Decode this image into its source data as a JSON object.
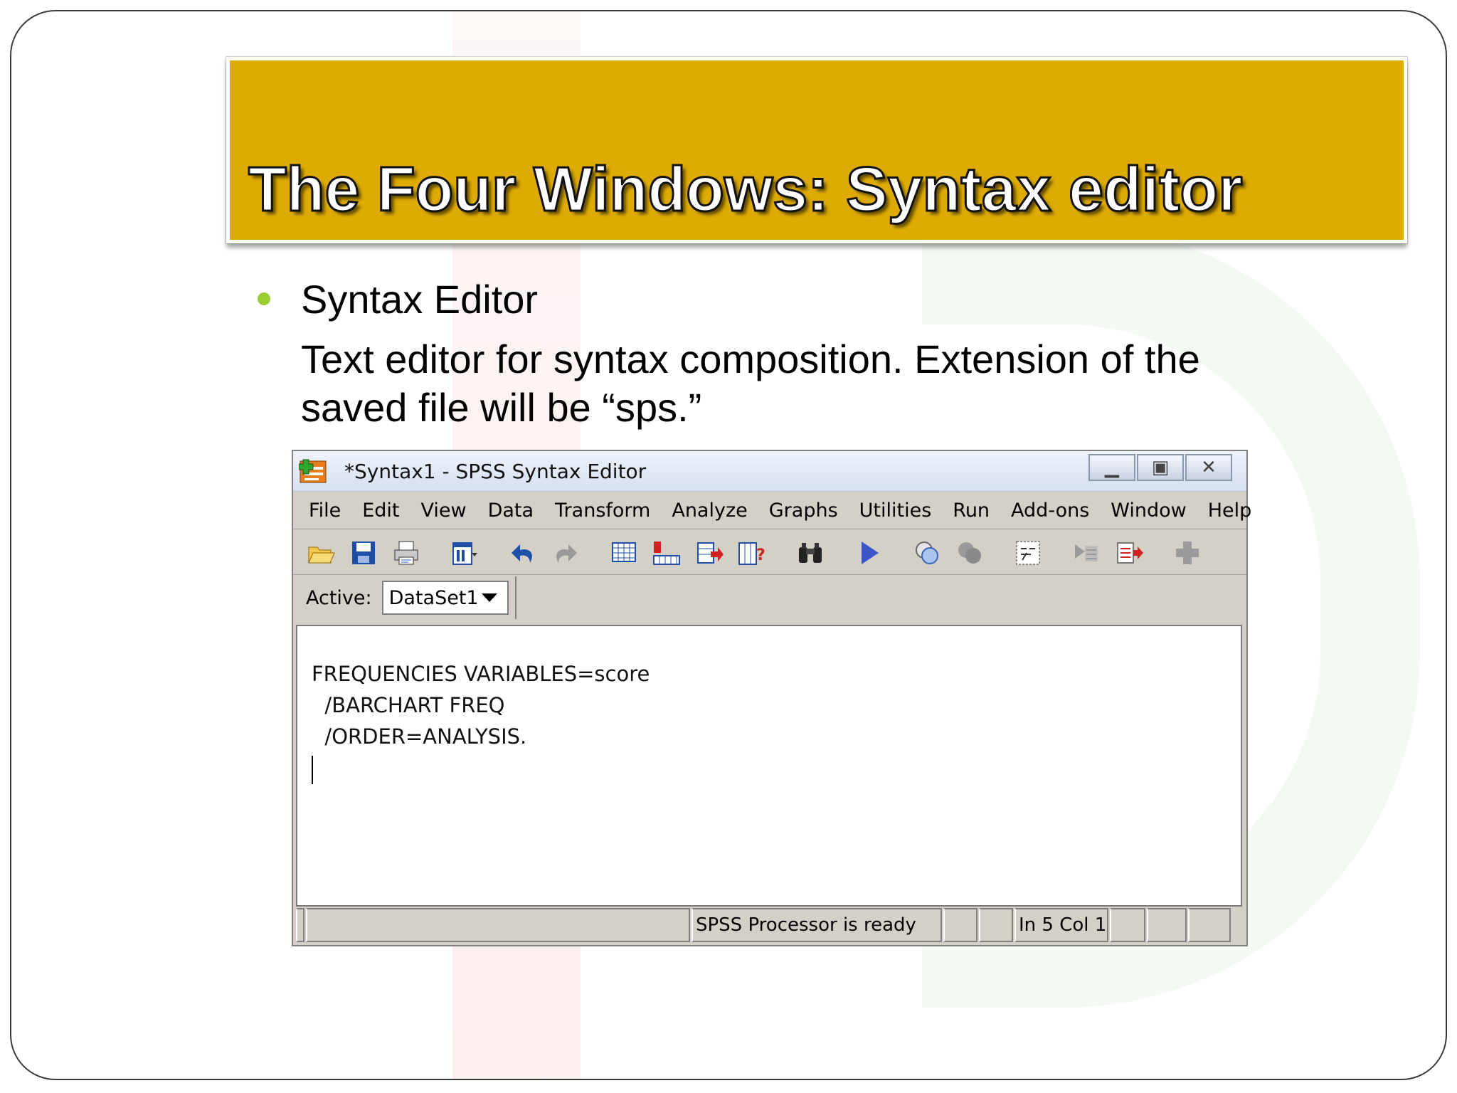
{
  "slide": {
    "title": "The Four Windows: Syntax editor",
    "bullet_heading": "Syntax Editor",
    "bullet_body": "Text editor for syntax composition. Extension of the saved file will be “sps.”"
  },
  "spss_window": {
    "title": "*Syntax1 - SPSS Syntax Editor",
    "menu": [
      "File",
      "Edit",
      "View",
      "Data",
      "Transform",
      "Analyze",
      "Graphs",
      "Utilities",
      "Run",
      "Add-ons",
      "Window",
      "Help"
    ],
    "toolbar_icons": [
      "open-icon",
      "save-icon",
      "print-icon",
      "dialog-recall-icon",
      "undo-icon",
      "redo-icon",
      "goto-data-icon",
      "goto-case-icon",
      "insert-variable-icon",
      "variables-icon",
      "find-icon",
      "run-icon",
      "bookmark-icon",
      "comment-icon",
      "syntax-help-icon",
      "indent-icon",
      "output-icon",
      "add-icon"
    ],
    "active_label": "Active:",
    "active_dataset": "DataSet1",
    "syntax_lines": [
      "FREQUENCIES VARIABLES=score",
      "  /BARCHART FREQ",
      "  /ORDER=ANALYSIS."
    ],
    "status_processor": "SPSS  Processor is ready",
    "status_position": "In 5 Col 1"
  }
}
